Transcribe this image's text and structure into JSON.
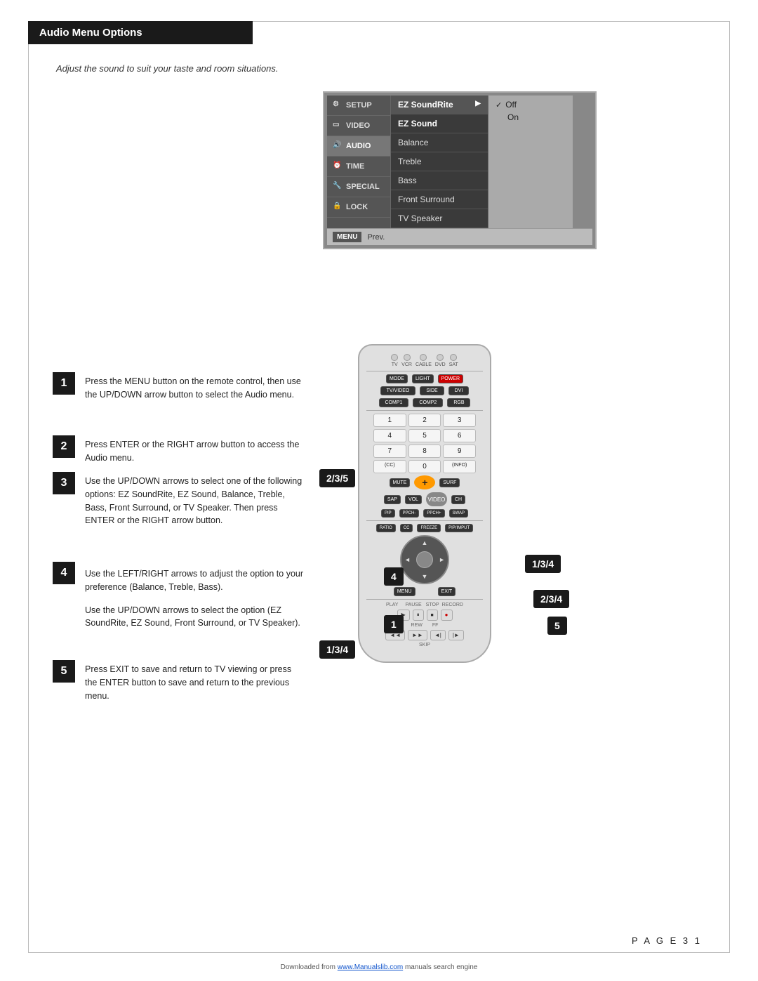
{
  "page": {
    "title": "Audio Menu Options",
    "subtitle": "Adjust the sound to suit your taste and room situations.",
    "page_number": "P A G E   3 1",
    "footer": "Downloaded from www.Manualslib.com manuals search engine"
  },
  "tv_menu": {
    "left_items": [
      {
        "label": "SETUP",
        "icon": "gear"
      },
      {
        "label": "VIDEO",
        "icon": "tv"
      },
      {
        "label": "AUDIO",
        "icon": "audio"
      },
      {
        "label": "TIME",
        "icon": "clock"
      },
      {
        "label": "SPECIAL",
        "icon": "wrench"
      },
      {
        "label": "LOCK",
        "icon": "lock"
      }
    ],
    "center_items": [
      {
        "label": "EZ SoundRite",
        "selected": true
      },
      {
        "label": "EZ Sound",
        "highlight": true
      },
      {
        "label": "Balance"
      },
      {
        "label": "Treble"
      },
      {
        "label": "Bass"
      },
      {
        "label": "Front Surround"
      },
      {
        "label": "TV Speaker"
      }
    ],
    "right_items": [
      {
        "label": "Off",
        "checked": true
      },
      {
        "label": "On"
      }
    ],
    "bottom": {
      "menu_label": "MENU",
      "prev_label": "Prev."
    }
  },
  "steps": [
    {
      "number": "1",
      "text": "Press the MENU button on the remote control, then use the UP/DOWN arrow button to select the Audio menu."
    },
    {
      "number": "2",
      "text": "Press ENTER or the RIGHT arrow button to access the Audio menu."
    },
    {
      "number": "3",
      "text": "Use the UP/DOWN arrows to select one of the following options: EZ SoundRite, EZ Sound, Balance, Treble, Bass, Front Surround, or TV Speaker. Then press ENTER or the RIGHT arrow button."
    },
    {
      "number": "4",
      "text_a": "Use the LEFT/RIGHT arrows to adjust the option to your preference (Balance, Treble, Bass).",
      "text_b": "Use the UP/DOWN arrows to select the option (EZ SoundRite, EZ Sound, Front Surround, or TV Speaker)."
    },
    {
      "number": "5",
      "text": "Press EXIT to save and return to TV viewing or press the ENTER button to save and return to the previous menu."
    }
  ],
  "callouts": [
    {
      "label": "2/3/5",
      "position": "left-mid"
    },
    {
      "label": "1/3/4",
      "position": "right-top"
    },
    {
      "label": "2/3/4",
      "position": "right-mid"
    },
    {
      "label": "5",
      "position": "right-bot"
    },
    {
      "label": "4",
      "position": "center-top"
    },
    {
      "label": "1",
      "position": "center-bot"
    },
    {
      "label": "1/3/4",
      "position": "bottom-left"
    }
  ],
  "remote": {
    "top_labels": [
      "TV",
      "VCR",
      "CABLE",
      "DVD",
      "SAT"
    ],
    "row1": [
      "MODE",
      "LIGHT",
      "POWER"
    ],
    "row2": [
      "TV/VIDEO",
      "SIDE",
      "DVI"
    ],
    "row3": [
      "COMP1",
      "COMP2",
      "RGB"
    ],
    "numbers": [
      "1",
      "2",
      "3",
      "4",
      "5",
      "6",
      "7",
      "8",
      "9",
      "(CC)",
      "0",
      "(INFO)"
    ],
    "middle": [
      "MUTE",
      "SURF"
    ],
    "vol_ch": [
      "SAP",
      "VOL",
      "CH"
    ],
    "row_pip": [
      "PIP",
      "PPCH-",
      "PPCH+",
      "SWAP"
    ],
    "row_cc": [
      "RATIO",
      "CC",
      "FREEZE",
      "PIP/IMPUT"
    ],
    "nav_labels": [
      "MENU",
      "EXIT"
    ],
    "transport": [
      "PLAY",
      "PAUSE",
      "STOP",
      "RECORD"
    ],
    "transport2": [
      "REW",
      "FF",
      "◄|",
      "|►"
    ],
    "skip": "SKIP"
  }
}
